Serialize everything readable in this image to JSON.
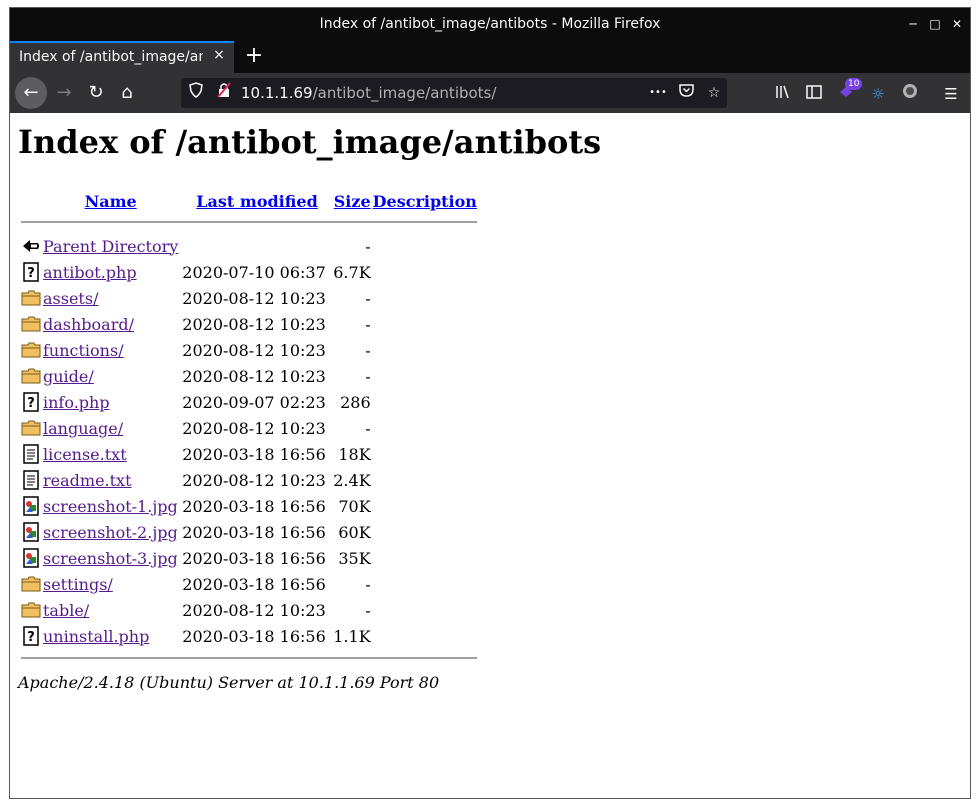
{
  "window": {
    "title": "Index of /antibot_image/antibots - Mozilla Firefox"
  },
  "tab": {
    "label": "Index of /antibot_image/antibots",
    "close": "×",
    "new_tab": "+"
  },
  "urlbar": {
    "host": "10.1.1.69",
    "path": "/antibot_image/antibots/",
    "more": "•••"
  },
  "toolbar": {
    "extension_badge": "10"
  },
  "page": {
    "heading": "Index of /antibot_image/antibots",
    "columns": {
      "name": "Name",
      "last_modified": "Last modified",
      "size": "Size",
      "description": "Description"
    },
    "rows": [
      {
        "icon": "back-icon",
        "name": "Parent Directory",
        "modified": "",
        "size": "-"
      },
      {
        "icon": "unknown-file-icon",
        "name": "antibot.php",
        "modified": "2020-07-10 06:37",
        "size": "6.7K"
      },
      {
        "icon": "folder-icon",
        "name": "assets/",
        "modified": "2020-08-12 10:23",
        "size": "-"
      },
      {
        "icon": "folder-icon",
        "name": "dashboard/",
        "modified": "2020-08-12 10:23",
        "size": "-"
      },
      {
        "icon": "folder-icon",
        "name": "functions/",
        "modified": "2020-08-12 10:23",
        "size": "-"
      },
      {
        "icon": "folder-icon",
        "name": "guide/",
        "modified": "2020-08-12 10:23",
        "size": "-"
      },
      {
        "icon": "unknown-file-icon",
        "name": "info.php",
        "modified": "2020-09-07 02:23",
        "size": "286"
      },
      {
        "icon": "folder-icon",
        "name": "language/",
        "modified": "2020-08-12 10:23",
        "size": "-"
      },
      {
        "icon": "text-file-icon",
        "name": "license.txt",
        "modified": "2020-03-18 16:56",
        "size": "18K"
      },
      {
        "icon": "text-file-icon",
        "name": "readme.txt",
        "modified": "2020-08-12 10:23",
        "size": "2.4K"
      },
      {
        "icon": "image-file-icon",
        "name": "screenshot-1.jpg",
        "modified": "2020-03-18 16:56",
        "size": "70K"
      },
      {
        "icon": "image-file-icon",
        "name": "screenshot-2.jpg",
        "modified": "2020-03-18 16:56",
        "size": "60K"
      },
      {
        "icon": "image-file-icon",
        "name": "screenshot-3.jpg",
        "modified": "2020-03-18 16:56",
        "size": "35K"
      },
      {
        "icon": "folder-icon",
        "name": "settings/",
        "modified": "2020-03-18 16:56",
        "size": "-"
      },
      {
        "icon": "folder-icon",
        "name": "table/",
        "modified": "2020-08-12 10:23",
        "size": "-"
      },
      {
        "icon": "unknown-file-icon",
        "name": "uninstall.php",
        "modified": "2020-03-18 16:56",
        "size": "1.1K"
      }
    ],
    "footer": "Apache/2.4.18 (Ubuntu) Server at 10.1.1.69 Port 80"
  },
  "colors": {
    "link_visited": "#551a8b",
    "link": "#0000ee",
    "chrome_dark": "#0c0c0d",
    "toolbar": "#323234",
    "folder": "#f0c060"
  }
}
